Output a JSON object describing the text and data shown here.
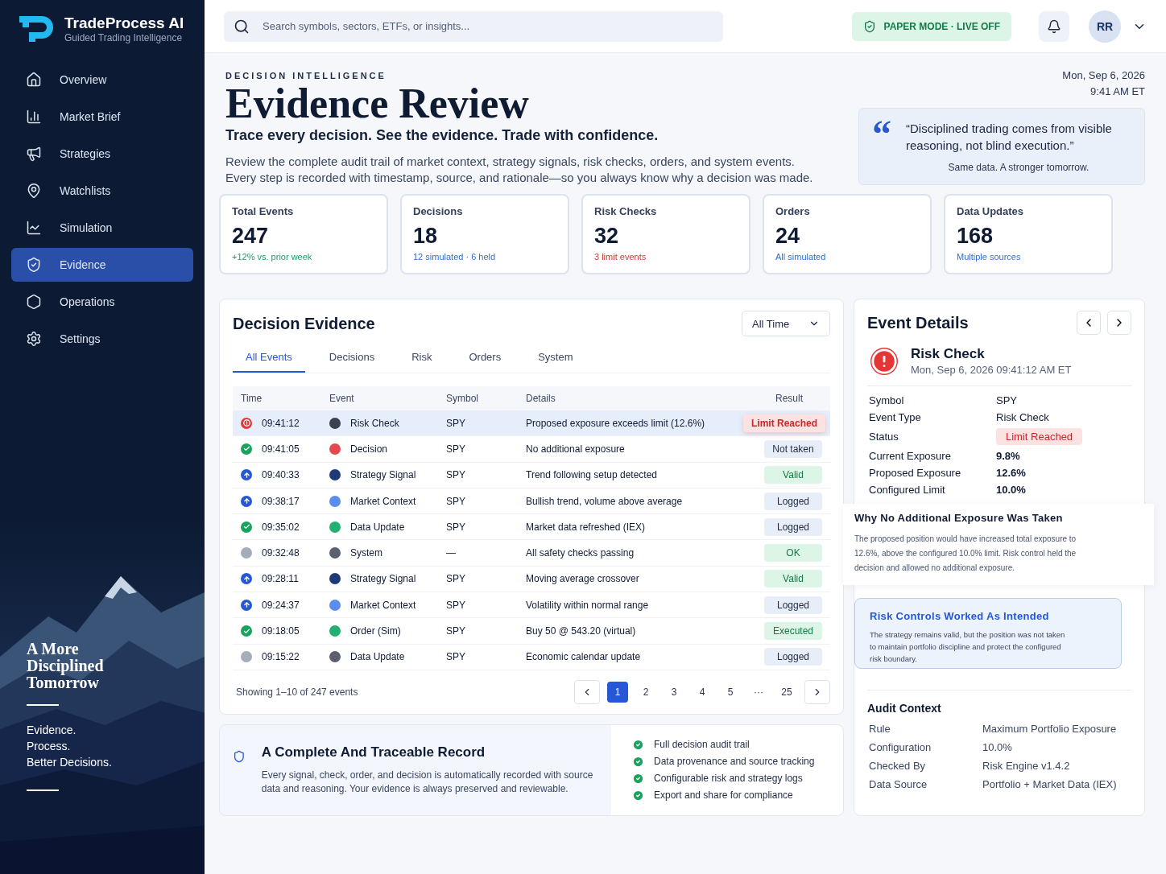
{
  "brand": {
    "name": "TradeProcess AI",
    "tagline": "Guided Trading Intelligence"
  },
  "nav": [
    {
      "label": "Overview",
      "selected": false
    },
    {
      "label": "Market Brief",
      "selected": false
    },
    {
      "label": "Strategies",
      "selected": false
    },
    {
      "label": "Watchlists",
      "selected": false
    },
    {
      "label": "Simulation",
      "selected": false
    },
    {
      "label": "Evidence",
      "selected": true
    },
    {
      "label": "Operations",
      "selected": false
    },
    {
      "label": "Settings",
      "selected": false
    }
  ],
  "sidebar_promo": {
    "title": "A More Disciplined Tomorrow",
    "lines": [
      "Evidence.",
      "Process.",
      "Better Decisions."
    ]
  },
  "search": {
    "placeholder": "Search symbols, sectors, ETFs, or insights..."
  },
  "mode_badge": "PAPER MODE · LIVE OFF",
  "avatar": "RR",
  "header": {
    "eyebrow": "DECISION INTELLIGENCE",
    "title": "Evidence Review",
    "subtitle": "Trace every decision. See the evidence. Trade with confidence.",
    "description": "Review the complete audit trail of market context, strategy signals, risk checks, orders, and system events. Every step is recorded with timestamp, source, and rationale—so you always know why a decision was made.",
    "date": "Mon, Sep 6, 2026",
    "time": "9:41 AM ET"
  },
  "quote": {
    "mark": "“",
    "text": "“Disciplined trading comes from visible reasoning, not blind execution.”",
    "footer": "Same data. A stronger tomorrow."
  },
  "stats": [
    {
      "label": "Total Events",
      "value": "247",
      "note": "+12% vs. prior week",
      "color": "#16a36a"
    },
    {
      "label": "Decisions",
      "value": "18",
      "note": "12 simulated · 6 held",
      "color": "#2f6fd6"
    },
    {
      "label": "Risk Checks",
      "value": "32",
      "note": "3 limit events",
      "color": "#d63a3a"
    },
    {
      "label": "Orders",
      "value": "24",
      "note": "All simulated",
      "color": "#2f6fd6"
    },
    {
      "label": "Data Updates",
      "value": "168",
      "note": "Multiple sources",
      "color": "#2f6fd6"
    }
  ],
  "evidence": {
    "title": "Decision Evidence",
    "range": "All Time",
    "tabs": [
      {
        "label": "All Events",
        "selected": true
      },
      {
        "label": "Decisions",
        "selected": false
      },
      {
        "label": "Risk",
        "selected": false
      },
      {
        "label": "Orders",
        "selected": false
      },
      {
        "label": "System",
        "selected": false
      }
    ],
    "columns": [
      "Time",
      "Event",
      "Symbol",
      "Details",
      "Result"
    ],
    "rows": [
      {
        "kind": "error",
        "time": "09:41:12",
        "color": "#3b4150",
        "event": "Risk Check",
        "symbol": "SPY",
        "details": "Proposed exposure exceeds limit (12.6%)",
        "result": {
          "label": "Limit Reached",
          "kind": "alert"
        },
        "selected": true
      },
      {
        "kind": "success",
        "time": "09:41:05",
        "color": "#e5484d",
        "event": "Decision",
        "symbol": "SPY",
        "details": "No additional exposure",
        "result": {
          "label": "Not taken",
          "kind": "neutral"
        },
        "selected": false
      },
      {
        "kind": "info",
        "time": "09:40:33",
        "color": "#1e3a78",
        "event": "Strategy Signal",
        "symbol": "SPY",
        "details": "Trend following setup detected",
        "result": {
          "label": "Valid",
          "kind": "good"
        },
        "selected": false
      },
      {
        "kind": "info",
        "time": "09:38:17",
        "color": "#5b8def",
        "event": "Market Context",
        "symbol": "SPY",
        "details": "Bullish trend, volume above average",
        "result": {
          "label": "Logged",
          "kind": "neutral"
        },
        "selected": false
      },
      {
        "kind": "success",
        "time": "09:35:02",
        "color": "#22b070",
        "event": "Data Update",
        "symbol": "SPY",
        "details": "Market data refreshed (IEX)",
        "result": {
          "label": "Logged",
          "kind": "neutral"
        },
        "selected": false
      },
      {
        "kind": "neutral",
        "time": "09:32:48",
        "color": "#5a6070",
        "event": "System",
        "symbol": "—",
        "details": "All safety checks passing",
        "result": {
          "label": "OK",
          "kind": "good"
        },
        "selected": false
      },
      {
        "kind": "info",
        "time": "09:28:11",
        "color": "#1e3a78",
        "event": "Strategy Signal",
        "symbol": "SPY",
        "details": "Moving average crossover",
        "result": {
          "label": "Valid",
          "kind": "good"
        },
        "selected": false
      },
      {
        "kind": "info",
        "time": "09:24:37",
        "color": "#5b8def",
        "event": "Market Context",
        "symbol": "SPY",
        "details": "Volatility within normal range",
        "result": {
          "label": "Logged",
          "kind": "neutral"
        },
        "selected": false
      },
      {
        "kind": "success",
        "time": "09:18:05",
        "color": "#22b070",
        "event": "Order (Sim)",
        "symbol": "SPY",
        "details": "Buy 50 @ 543.20 (virtual)",
        "result": {
          "label": "Executed",
          "kind": "good"
        },
        "selected": false
      },
      {
        "kind": "neutral",
        "time": "09:15:22",
        "color": "#5a6070",
        "event": "Data Update",
        "symbol": "SPY",
        "details": "Economic calendar update",
        "result": {
          "label": "Logged",
          "kind": "neutral"
        },
        "selected": false
      }
    ],
    "showing": "Showing 1–10 of 247 events",
    "pages": [
      {
        "label": "1",
        "selected": true
      },
      {
        "label": "2",
        "selected": false
      },
      {
        "label": "3",
        "selected": false
      },
      {
        "label": "4",
        "selected": false
      },
      {
        "label": "5",
        "selected": false
      },
      {
        "label": "···",
        "selected": false
      },
      {
        "label": "25",
        "selected": false
      }
    ]
  },
  "record": {
    "title": "A Complete And Traceable Record",
    "text": "Every signal, check, order, and decision is automatically recorded with source data and reasoning. Your evidence is always preserved and reviewable.",
    "features": [
      "Full decision audit trail",
      "Data provenance and source tracking",
      "Configurable risk and strategy logs",
      "Export and share for compliance"
    ]
  },
  "details": {
    "title": "Event Details",
    "event": "Risk Check",
    "timestamp": "Mon, Sep 6, 2026 09:41:12 AM ET",
    "fields": [
      {
        "label": "Symbol",
        "value": "SPY",
        "kind": "plain"
      },
      {
        "label": "Event Type",
        "value": "Risk Check",
        "kind": "plain"
      },
      {
        "label": "Status",
        "value": "Limit Reached",
        "kind": "badge"
      },
      {
        "label": "Current Exposure",
        "value": "9.8%",
        "kind": "bold"
      },
      {
        "label": "Proposed Exposure",
        "value": "12.6%",
        "kind": "bold"
      },
      {
        "label": "Configured Limit",
        "value": "10.0%",
        "kind": "bold"
      }
    ],
    "why": {
      "title": "Why No Additional Exposure Was Taken",
      "text": "The proposed position would have increased total exposure to 12.6%, above the configured 10.0% limit. Risk control held the decision and allowed no additional exposure."
    },
    "callout": {
      "title": "Risk Controls Worked As Intended",
      "text": "The strategy remains valid, but the position was not taken to maintain portfolio discipline and protect the configured risk boundary."
    },
    "audit": {
      "title": "Audit Context",
      "fields": [
        {
          "label": "Rule",
          "value": "Maximum Portfolio Exposure"
        },
        {
          "label": "Configuration",
          "value": "10.0%"
        },
        {
          "label": "Checked By",
          "value": "Risk Engine v1.4.2"
        },
        {
          "label": "Data Source",
          "value": "Portfolio + Market Data (IEX)"
        }
      ]
    }
  }
}
